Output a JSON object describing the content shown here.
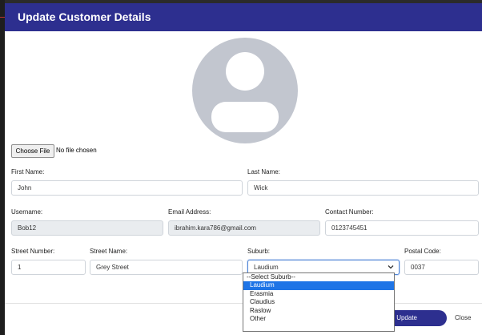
{
  "modal": {
    "title": "Update Customer Details"
  },
  "avatar": {
    "icon": "user-avatar-placeholder-icon",
    "color": "#c2c6cf"
  },
  "file_input": {
    "button_label": "Choose File",
    "status": "No file chosen"
  },
  "form": {
    "first_name": {
      "label": "First Name:",
      "value": "John"
    },
    "last_name": {
      "label": "Last Name:",
      "value": "Wick"
    },
    "username": {
      "label": "Username:",
      "value": "Bob12"
    },
    "email": {
      "label": "Email Address:",
      "value": "ibrahim.kara786@gmail.com"
    },
    "contact": {
      "label": "Contact Number:",
      "value": "0123745451"
    },
    "street_number": {
      "label": "Street Number:",
      "value": "1"
    },
    "street_name": {
      "label": "Street Name:",
      "value": "Grey Street"
    },
    "suburb": {
      "label": "Suburb:",
      "value": "Laudium",
      "options": [
        "--Select Suburb--",
        "Laudium",
        "Erasmia",
        "Claudius",
        "Raslow",
        "Other"
      ],
      "selected_index": 1
    },
    "postal_code": {
      "label": "Postal Code:",
      "value": "0037"
    }
  },
  "footer": {
    "update_label": "Update",
    "close_label": "Close"
  },
  "colors": {
    "header": "#2d2f8f",
    "primary_button": "#2d2f8f",
    "dropdown_highlight": "#1e74e6",
    "readonly_field": "#e9ecef"
  }
}
